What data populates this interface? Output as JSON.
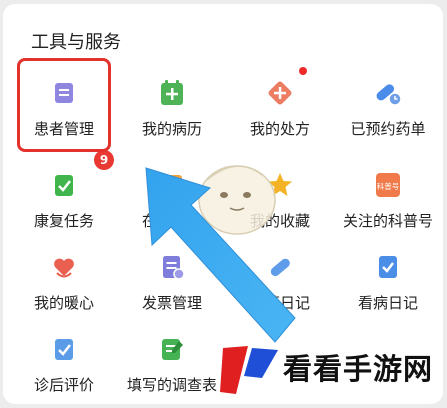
{
  "section": {
    "title": "工具与服务"
  },
  "items": [
    {
      "label": "患者管理",
      "icon": "patient-management-icon"
    },
    {
      "label": "我的病历",
      "icon": "medical-record-icon"
    },
    {
      "label": "我的处方",
      "icon": "prescription-icon"
    },
    {
      "label": "已预约药单",
      "icon": "reserved-medicine-icon"
    },
    {
      "label": "康复任务",
      "icon": "rehab-task-icon"
    },
    {
      "label": "在线评价",
      "icon": "online-review-icon"
    },
    {
      "label": "我的收藏",
      "icon": "favorites-star-icon"
    },
    {
      "label": "关注的科普号",
      "icon": "followed-science-icon",
      "icon_text": "科普号"
    },
    {
      "label": "我的暖心",
      "icon": "warm-heart-icon"
    },
    {
      "label": "发票管理",
      "icon": "invoice-icon"
    },
    {
      "label": "用药日记",
      "icon": "medication-diary-icon"
    },
    {
      "label": "看病日记",
      "icon": "visit-diary-icon"
    },
    {
      "label": "诊后评价",
      "icon": "post-visit-review-icon"
    },
    {
      "label": "填写的调查表",
      "icon": "survey-icon"
    }
  ],
  "badge": {
    "count": "9"
  },
  "watermark": {
    "text": "看看手游网"
  },
  "colors": {
    "highlight": "#e3322c",
    "arrow": "#3aa8f0",
    "badge": "#e83a32"
  }
}
